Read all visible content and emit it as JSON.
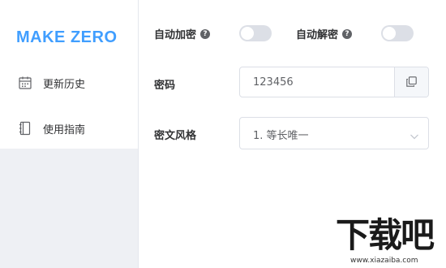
{
  "sidebar": {
    "logo": "MAKE ZERO",
    "items": [
      {
        "label": "更新历史",
        "icon": "calendar-icon"
      },
      {
        "label": "使用指南",
        "icon": "notebook-icon"
      }
    ]
  },
  "settings": {
    "auto_encrypt": {
      "label": "自动加密",
      "enabled": false
    },
    "auto_decrypt": {
      "label": "自动解密",
      "enabled": false
    },
    "help_glyph": "?",
    "password": {
      "label": "密码",
      "value": "123456"
    },
    "cipher_style": {
      "label": "密文风格",
      "selected": "1. 等长唯一"
    }
  },
  "watermark": {
    "text": "下载吧",
    "url": "www.xiazaiba.com"
  },
  "colors": {
    "accent": "#409eff",
    "switch_off": "#dcdfe6",
    "sidebar_bg": "#eef0f4"
  }
}
